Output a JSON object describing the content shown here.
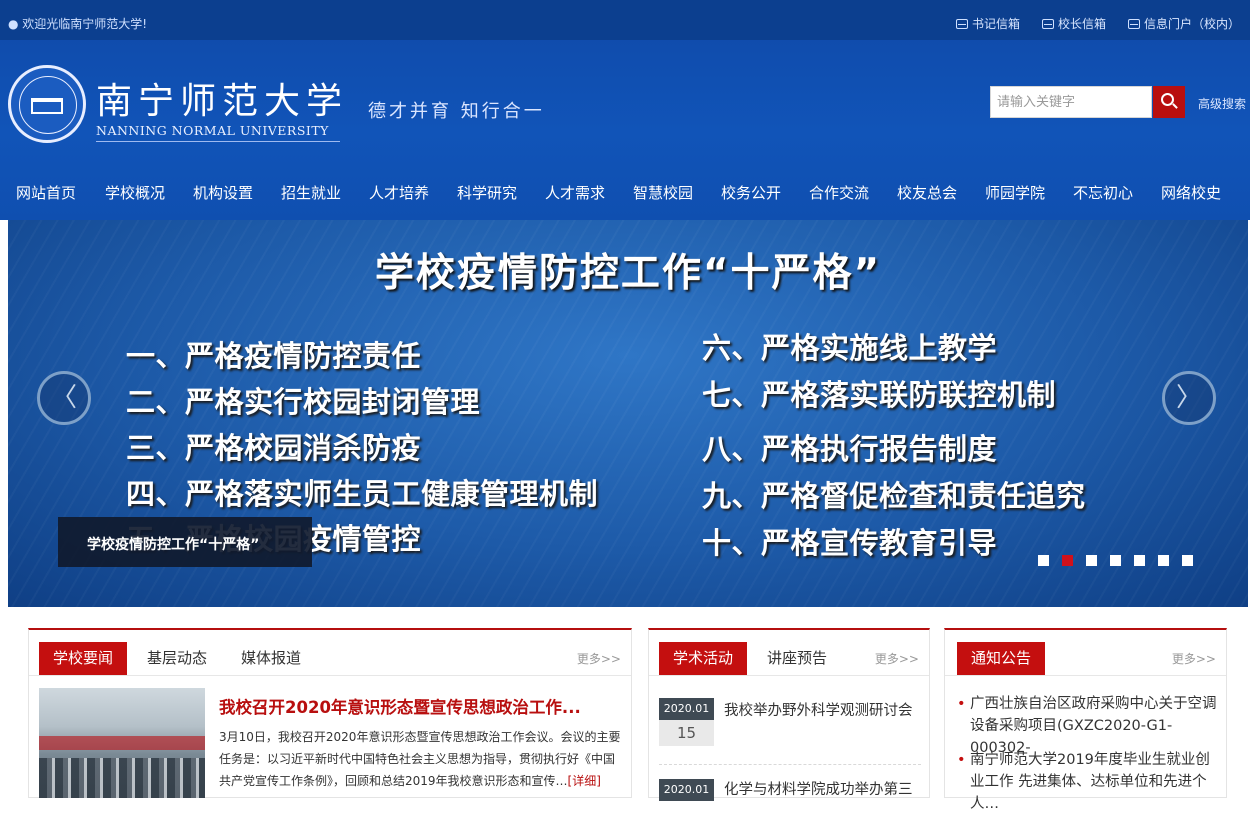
{
  "topbar": {
    "welcome": "欢迎光临南宁师范大学!",
    "links": [
      "书记信箱",
      "校长信箱",
      "信息门户（校内）"
    ]
  },
  "logo": {
    "name_cn": "南宁师范大学",
    "name_en": "NANNING NORMAL UNIVERSITY",
    "motto": "德才并育 知行合一"
  },
  "search": {
    "placeholder": "请输入关键字",
    "advanced_label": "高级搜索"
  },
  "nav": {
    "items": [
      "网站首页",
      "学校概况",
      "机构设置",
      "招生就业",
      "人才培养",
      "科学研究",
      "人才需求",
      "智慧校园",
      "校务公开",
      "合作交流",
      "校友总会",
      "师园学院",
      "不忘初心",
      "网络校史"
    ]
  },
  "banner": {
    "title": "学校疫情防控工作“十严格”",
    "rules_left": [
      "一、严格疫情防控责任",
      "二、严格实行校园封闭管理",
      "三、严格校园消杀防疫",
      "四、严格落实师生员工健康管理机制",
      "五、严格校园疫情管控"
    ],
    "rules_right": [
      "六、严格实施线上教学",
      "七、严格落实联防联控机制",
      "八、严格执行报告制度",
      "九、严格督促检查和责任追究",
      "十、严格宣传教育引导"
    ],
    "caption": "学校疫情防控工作“十严格”",
    "prev_arrow": "〈",
    "next_arrow": "〉",
    "slide_count": 7,
    "active_slide": 2,
    "active_color": "#d0111b"
  },
  "news": {
    "tabs": [
      "学校要闻",
      "基层动态",
      "媒体报道"
    ],
    "more": "更多>>",
    "headline": "我校召开2020年意识形态暨宣传思想政治工作...",
    "summary": "3月10日，我校召开2020年意识形态暨宣传思想政治工作会议。会议的主要任务是：以习近平新时代中国特色社会主义思想为指导，贯彻执行好《中国共产党宣传工作条例》，回顾和总结2019年我校意识形态和宣传…",
    "detail": "[详细]"
  },
  "academic": {
    "tabs": [
      "学术活动",
      "讲座预告"
    ],
    "more": "更多>>",
    "events": [
      {
        "month": "2020.01",
        "day": "15",
        "title": "我校举办野外科学观测研讨会"
      },
      {
        "month": "2020.01",
        "day": "",
        "title": "化学与材料学院成功举办第三"
      }
    ]
  },
  "notices": {
    "tabs": [
      "通知公告"
    ],
    "more": "更多>>",
    "items": [
      "广西壮族自治区政府采购中心关于空调设备采购项目(GXZC2020-G1-000302-",
      "南宁师范大学2019年度毕业生就业创业工作 先进集体、达标单位和先进个人…"
    ]
  },
  "colors": {
    "header_blue": "#1154b8",
    "topbar_blue": "#0c3f8f",
    "accent_red": "#c40f0f"
  }
}
